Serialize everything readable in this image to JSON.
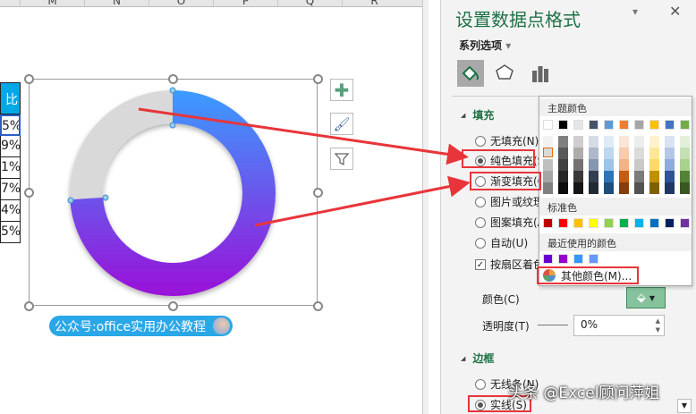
{
  "sheet": {
    "columns": [
      "M",
      "N",
      "O",
      "P",
      "Q",
      "R"
    ],
    "table_header": "比",
    "table_values": [
      "5%",
      "9%",
      "1%",
      "7%",
      "4%",
      "5%"
    ]
  },
  "chart": {
    "label": "公众号:office实用办公教程",
    "filled_fraction": 0.74,
    "gradient_top": "#3b9cff",
    "gradient_bottom": "#9a10d8",
    "remainder_color": "#d9d9d9"
  },
  "pane": {
    "title": "设置数据点格式",
    "series_options": "系列选项",
    "fill_section": "填充",
    "fill_options": [
      "无填充(N)",
      "纯色填充(S)",
      "渐变填充(G)",
      "图片或纹理填充(P)",
      "图案填充(A)",
      "自动(U)"
    ],
    "vary_colors": "按扇区着色(V)",
    "color_label": "颜色(C)",
    "transparency_label": "透明度(T)",
    "transparency_value": "0%",
    "border_section": "边框",
    "border_options": [
      "无线条(N)",
      "实线(S)"
    ]
  },
  "palette": {
    "theme_title": "主题颜色",
    "standard_title": "标准色",
    "recent_title": "最近使用的颜色",
    "more_colors": "其他颜色(M)...",
    "theme": [
      "#ffffff",
      "#000000",
      "#e7e6e6",
      "#44546a",
      "#5b9bd5",
      "#ed7d31",
      "#a5a5a5",
      "#ffc000",
      "#4472c4",
      "#70ad47"
    ],
    "shades": [
      [
        "#f2f2f2",
        "#d9d9d9",
        "#bfbfbf",
        "#a6a6a6",
        "#808080"
      ],
      [
        "#808080",
        "#595959",
        "#404040",
        "#262626",
        "#0d0d0d"
      ],
      [
        "#d0cece",
        "#aeabab",
        "#757171",
        "#3a3838",
        "#171616"
      ],
      [
        "#d6dce5",
        "#adb9ca",
        "#8497b0",
        "#333f50",
        "#222a35"
      ],
      [
        "#deebf7",
        "#bdd7ee",
        "#9dc3e6",
        "#2e75b6",
        "#1f4e79"
      ],
      [
        "#fbe5d6",
        "#f8cbad",
        "#f4b183",
        "#c55a11",
        "#843c0c"
      ],
      [
        "#ededed",
        "#dbdbdb",
        "#c9c9c9",
        "#7b7b7b",
        "#525252"
      ],
      [
        "#fff2cc",
        "#ffe699",
        "#ffd966",
        "#bf9000",
        "#7f6000"
      ],
      [
        "#dae3f3",
        "#b4c7e7",
        "#8faadc",
        "#2f5597",
        "#203864"
      ],
      [
        "#e2f0d9",
        "#c5e0b4",
        "#a9d18e",
        "#548235",
        "#385723"
      ]
    ],
    "standard": [
      "#c00000",
      "#ff0000",
      "#ffc000",
      "#ffff00",
      "#92d050",
      "#00b050",
      "#00b0f0",
      "#0070c0",
      "#002060",
      "#7030a0"
    ],
    "recent": [
      "#6a00d0",
      "#9a00cc",
      "#3399ff",
      "#6699ff"
    ]
  },
  "watermark": "头条 @Excel顾问萍姐"
}
